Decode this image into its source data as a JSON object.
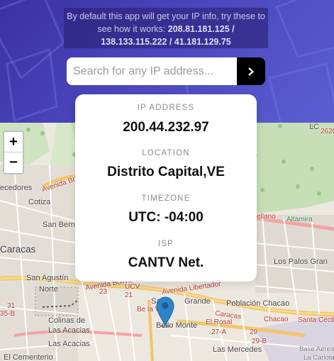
{
  "header": {
    "hint_prefix": "By default this app will get your IP info, try these to see how it works: ",
    "hint_ips": "208.81.181.125 / 138.133.115.222 / 41.181.129.75"
  },
  "search": {
    "placeholder": "Search for any IP address...",
    "value": "",
    "button_icon": "chevron-right-icon"
  },
  "info": {
    "ip_label": "IP ADDRESS",
    "ip_value": "200.44.232.97",
    "location_label": "LOCATION",
    "location_value": "Distrito Capital,VE",
    "timezone_label": "TIMEZONE",
    "timezone_value": "UTC: -04:00",
    "isp_label": "ISP",
    "isp_value": "CANTV Net."
  },
  "map": {
    "zoom_in": "+",
    "zoom_out": "−",
    "marker_icon": "map-pin-icon",
    "labels": {
      "sabana_grande_left": "Sab",
      "sabana_grande_right": "Grande",
      "ecedores": "ecedores",
      "cotiza": "Cotiza",
      "san_bern": "San Bern",
      "caracas": "Caracas",
      "san_agustin": "San Agustín",
      "norte": "Norte",
      "colinas_1": "Colinas de",
      "colinas_2": "Las Acacias",
      "las_acacias": "Las Acacias",
      "el_cementerio": "El Cementerio",
      "los_palos_grandes": "Los Palos Gran",
      "poblacion_chacao": "Población Chacao",
      "bello_monte": "Bello Monte",
      "las_mercedes": "Las Mercedes",
      "altamira": "Altamira",
      "chacao": "Chacao",
      "santa_cecilia": "Santa Cecil",
      "avenida_libertador": "Avenida Libertador",
      "avenida_bolivar": "Avenida Bolívar",
      "el_rosal": "El Rosal",
      "base_aerea": "Base Aérea",
      "la_carlota": "La Carlota",
      "bella_vista": "Be    la Vista",
      "caracas_road": "Caracas",
      "ellano": "ellano",
      "ucv": "UCV",
      "road_23": "23",
      "road_21": "21",
      "road_27a": "27-A",
      "road_29": "29",
      "road_29b": "29-B",
      "road_31": "31",
      "road_35b": "35-B",
      "road_2620": "2620",
      "road_lc": "LC",
      "avenida_boyaca": "Avenida Boya"
    }
  }
}
